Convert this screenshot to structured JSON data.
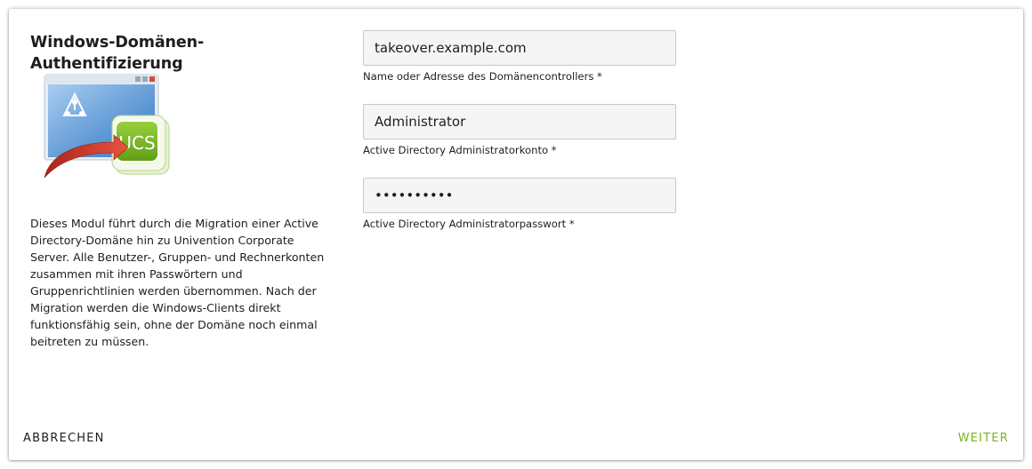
{
  "dialog": {
    "title": "Windows-Domänen-Authentifizierung",
    "description": "Dieses Modul führt durch die Migration einer Active Directory-Domäne hin zu Univention Corporate Server. Alle Benutzer-, Gruppen- und Rechnerkonten zusammen mit ihren Passwörtern und Gruppenrichtlinien werden übernommen. Nach der Migration werden die Windows-Clients direkt funktionsfähig sein, ohne der Domäne noch einmal beitreten zu müssen.",
    "illustration": {
      "badge_text": "UCS",
      "icon": "ad-to-ucs-migration-icon"
    }
  },
  "form": {
    "domain_controller": {
      "value": "takeover.example.com",
      "label": "Name oder Adresse des Domänencontrollers *"
    },
    "admin_account": {
      "value": "Administrator",
      "label": "Active Directory Administratorkonto *"
    },
    "admin_password": {
      "value": "••••••••••",
      "label": "Active Directory Administratorpasswort *"
    }
  },
  "footer": {
    "cancel_label": "ABBRECHEN",
    "next_label": "WEITER"
  },
  "colors": {
    "accent": "#7ab51d",
    "input_bg": "#f5f5f5",
    "text": "#1e1e1e"
  }
}
